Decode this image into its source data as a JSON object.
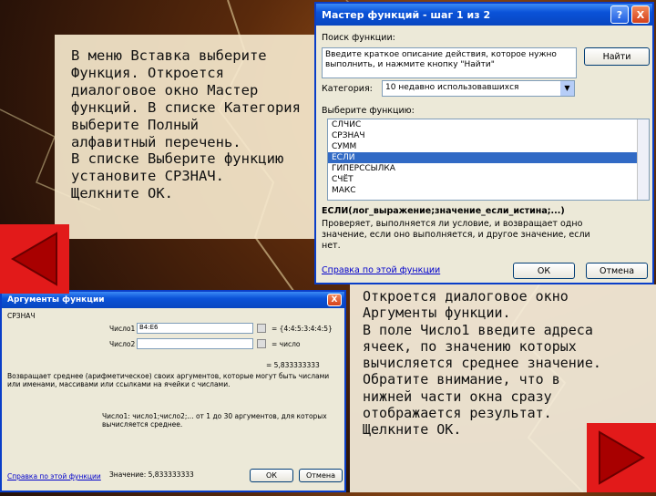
{
  "note1": {
    "lines": [
      "В меню Вставка выберите",
      "Функция. Откроется",
      "диалоговое окно Мастер",
      "функций. В списке Категория",
      "выберите Полный",
      "алфавитный перечень.",
      "В списке Выберите функцию",
      "установите СРЗНАЧ.",
      "Щелкните ОК."
    ]
  },
  "note2": {
    "lines": [
      "Откроется диалоговое окно",
      "Аргументы функции.",
      "В поле Число1 введите адреса",
      "ячеек, по значению которых",
      "вычисляется среднее значение.",
      "Обратите внимание, что в",
      "нижней части окна сразу",
      "отображается результат.",
      "Щелкните ОК."
    ]
  },
  "wizard": {
    "title": "Мастер функций - шаг 1 из 2",
    "help_btn": "?",
    "close_btn": "X",
    "search_label": "Поиск функции:",
    "search_value": "Введите краткое описание действия, которое нужно выполнить, и нажмите кнопку \"Найти\"",
    "find_btn": "Найти",
    "category_label": "Категория:",
    "category_value": "10 недавно использовавшихся",
    "select_label": "Выберите функцию:",
    "functions": [
      "СЛЧИС",
      "СРЗНАЧ",
      "СУММ",
      "ЕСЛИ",
      "ГИПЕРССЫЛКА",
      "СЧЁТ",
      "МАКС"
    ],
    "selected_index": 3,
    "signature": "ЕСЛИ(лог_выражение;значение_если_истина;...)",
    "description": "Проверяет, выполняется ли условие, и возвращает одно значение, если оно выполняется, и другое значение, если нет.",
    "help_link": "Справка по этой функции",
    "ok_btn": "ОК",
    "cancel_btn": "Отмена"
  },
  "args": {
    "title": "Аргументы функции",
    "close_btn": "X",
    "func_name": "СРЗНАЧ",
    "arg1_label": "Число1",
    "arg1_value": "B4:E6",
    "arg1_result": "= {4:4:5:3:4:4:5}",
    "arg2_label": "Число2",
    "arg2_value": "",
    "arg2_result": "= число",
    "total_result": "= 5,833333333",
    "description": "Возвращает среднее (арифметическое) своих аргументов, которые могут быть числами или именами, массивами или ссылками на ячейки с числами.",
    "arg_desc": "Число1: число1;число2;... от 1 до 30 аргументов, для которых вычисляется среднее.",
    "value_label": "Значение: 5,833333333",
    "help_link": "Справка по этой функции",
    "ok_btn": "ОК",
    "cancel_btn": "Отмена"
  },
  "nav": {
    "prev_icon": "left-triangle-icon",
    "next_icon": "right-triangle-icon",
    "color": "#e21a1a"
  },
  "colors": {
    "titlebar": "#0a52d8",
    "selection": "#316ac5",
    "dialog_bg": "#ece9d8"
  }
}
